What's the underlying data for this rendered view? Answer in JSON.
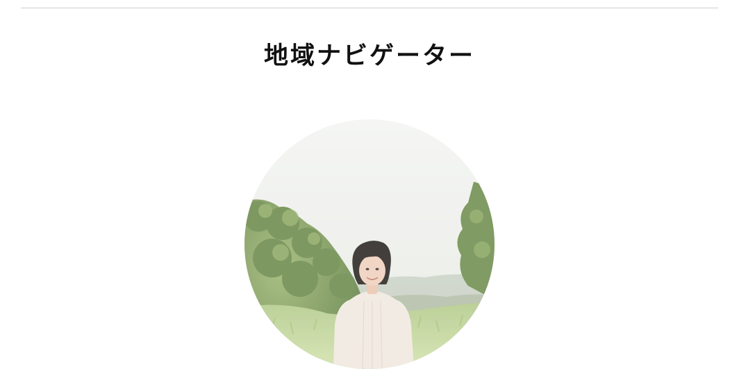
{
  "section": {
    "title": "地域ナビゲーター"
  },
  "portrait": {
    "icon": "person-portrait",
    "palette": {
      "sky": "#f2f3f1",
      "haze": "#e6e9e2",
      "far_hill": "#b9c4b6",
      "foliage_dark": "#5f7d45",
      "foliage_mid": "#86a35f",
      "foliage_light": "#b7cc8d",
      "grass": "#c6d99a",
      "hair": "#2a2522",
      "skin": "#f0d1bd",
      "blouse": "#f1e9e0"
    }
  }
}
